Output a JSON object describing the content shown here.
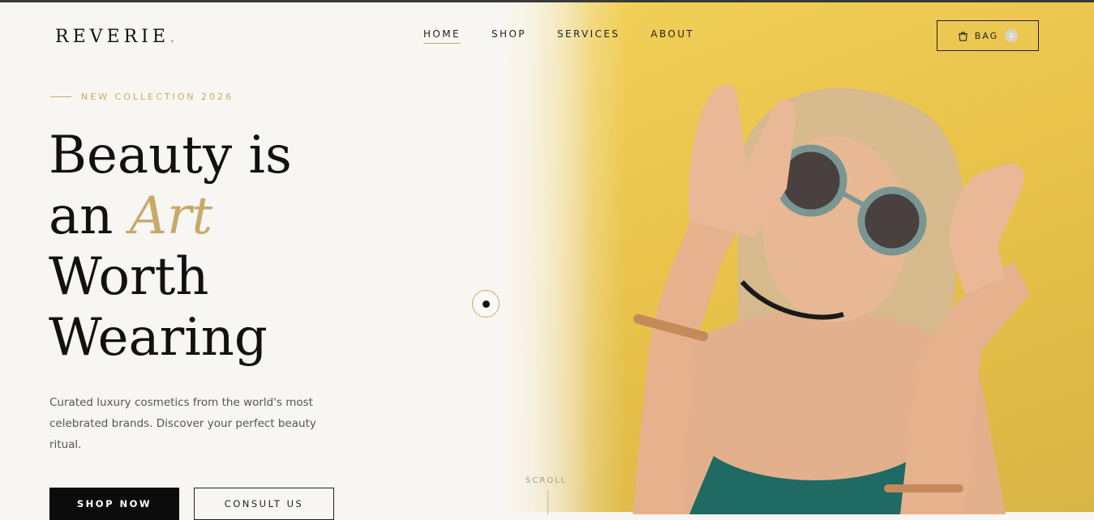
{
  "brand": {
    "name": "REVERIE",
    "dot": "."
  },
  "nav": {
    "items": [
      {
        "label": "HOME",
        "active": true
      },
      {
        "label": "SHOP"
      },
      {
        "label": "SERVICES"
      },
      {
        "label": "ABOUT"
      }
    ]
  },
  "bag": {
    "label": "BAG",
    "count": "0",
    "icon": "bag-icon"
  },
  "hero": {
    "eyebrow": "NEW COLLECTION 2026",
    "line1": "Beauty is",
    "line2_pre": "an ",
    "line2_accent": "Art",
    "line3": "Worth",
    "line4": "Wearing",
    "description": "Curated luxury cosmetics from the world's most celebrated brands. Discover your perfect beauty ritual.",
    "primary_button": "SHOP NOW",
    "secondary_button": "CONSULT US",
    "scroll_label": "SCROLL"
  },
  "colors": {
    "accent": "#c9a86a",
    "dark": "#0c0c0c",
    "background": "#f8f6f2",
    "image_bg": "#eec94f"
  }
}
